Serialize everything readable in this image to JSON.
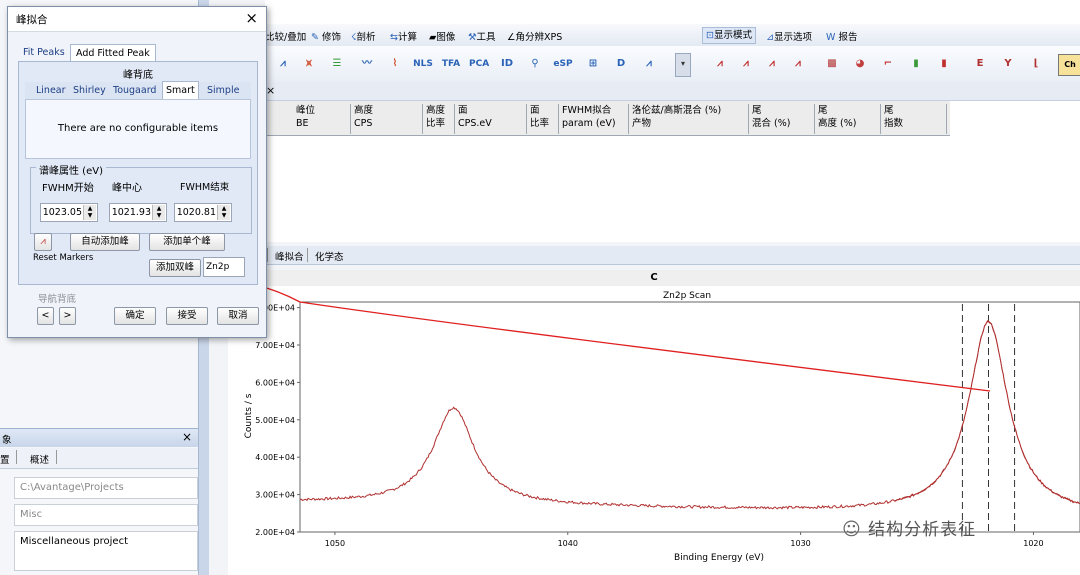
{
  "window": {
    "toolbar_tabs": [
      "比较/叠加",
      "修饰",
      "剖析",
      "计算",
      "图像",
      "工具",
      "角分辨XPS",
      "显示模式",
      "显示选项",
      "报告"
    ],
    "active_tab": "显示模式",
    "toolbar_button_labels": [
      "NLS",
      "TFA",
      "PCA",
      "ID",
      "eSP",
      "Ch"
    ]
  },
  "peak_table": {
    "columns": [
      {
        "line1": "峰位",
        "line2": "BE"
      },
      {
        "line1": "高度",
        "line2": "CPS"
      },
      {
        "line1": "高度",
        "line2": "比率"
      },
      {
        "line1": "面",
        "line2": "CPS.eV"
      },
      {
        "line1": "面",
        "line2": "比率"
      },
      {
        "line1": "FWHM拟合",
        "line2": "param (eV)"
      },
      {
        "line1": "洛伦兹/高斯混合 (%)",
        "line2": "产物"
      },
      {
        "line1": "尾",
        "line2": "混合 (%)"
      },
      {
        "line1": "尾",
        "line2": "高度 (%)"
      },
      {
        "line1": "尾",
        "line2": "指数"
      }
    ]
  },
  "view_tabs": [
    "峰拟合",
    "化学态"
  ],
  "left_pane": {
    "header_fragment": "象",
    "tabs": [
      "置",
      "概述"
    ],
    "fields": [
      "C:\\Avantage\\Projects",
      "Misc",
      "Miscellaneous project"
    ]
  },
  "dialog": {
    "title": "峰拟合",
    "tabs": [
      "Fit Peaks",
      "Add Fitted Peak"
    ],
    "active_tab": "Add Fitted Peak",
    "background_title": "峰背底",
    "background_tabs": [
      "Linear",
      "Shirley",
      "Tougaard",
      "Smart",
      "Simple"
    ],
    "active_background": "Smart",
    "no_items_text": "There are no configurable items",
    "props_title": "谱峰属性 (eV)",
    "fwhm_start_label": "FWHM开始",
    "peak_center_label": "峰中心",
    "fwhm_end_label": "FWHM结束",
    "fwhm_start_value": "1023.05",
    "peak_center_value": "1021.93",
    "fwhm_end_value": "1020.81",
    "auto_add_label": "自动添加峰",
    "add_single_label": "添加单个峰",
    "reset_markers_label": "Reset Markers",
    "add_doublet_label": "添加双峰",
    "doublet_name_value": "Zn2p",
    "nav_bg_label": "导航背底",
    "ok_label": "确定",
    "accept_label": "接受",
    "cancel_label": "取消",
    "prev_glyph": "<",
    "next_glyph": ">"
  },
  "chart_head": "C",
  "chart_data": {
    "type": "line",
    "title": "Zn2p Scan",
    "xlabel": "Binding Energy (eV)",
    "ylabel": "Counts / s",
    "xlim": [
      1051.5,
      1018
    ],
    "ylim": [
      20000,
      81500
    ],
    "x_ticks": [
      1050,
      1040,
      1030,
      1020
    ],
    "y_ticks": [
      "2.00E+04",
      "3.00E+04",
      "4.00E+04",
      "5.00E+04",
      "6.00E+04",
      "7.00E+04",
      "8.00E+04"
    ],
    "y_tick_values": [
      20000,
      30000,
      40000,
      50000,
      60000,
      70000,
      80000
    ],
    "series_color": "#b03030",
    "background_level": 24300,
    "peaks": [
      {
        "center": 1044.9,
        "height": 50200,
        "fwhm": 2.3
      },
      {
        "center": 1021.93,
        "height": 75800,
        "fwhm": 2.2
      }
    ],
    "markers": [
      1023.05,
      1021.93,
      1020.81
    ]
  },
  "annotation_color": "#e02020",
  "watermark": "结构分析表征"
}
